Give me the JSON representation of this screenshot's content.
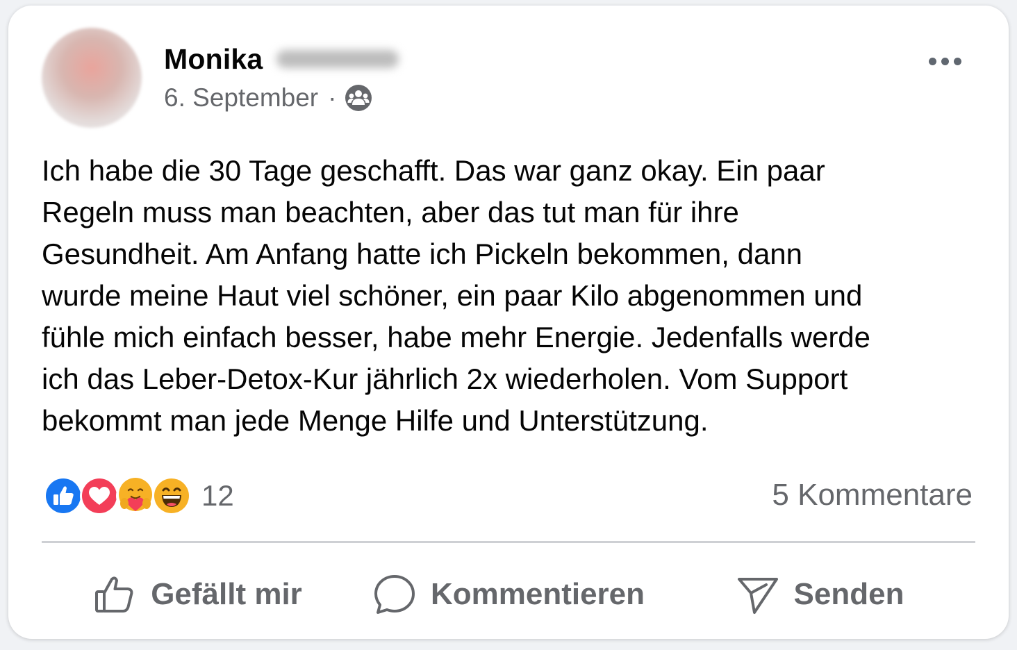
{
  "post": {
    "author_name": "Monika",
    "date": "6. September",
    "separator": "·",
    "audience_icon": "group-icon",
    "more_icon": "more-options-icon",
    "text": "Ich habe die 30 Tage geschafft. Das war ganz okay. Ein paar\nRegeln muss man beachten, aber das tut man für ihre\nGesundheit. Am Anfang hatte ich Pickeln bekommen, dann\nwurde meine Haut viel schöner, ein paar Kilo abgenommen und\nfühle mich einfach besser, habe mehr Energie. Jedenfalls werde\nich das Leber-Detox-Kur jährlich 2x wiederholen. Vom Support\nbekommt man jede Menge Hilfe und Unterstützung."
  },
  "reactions": {
    "icons": [
      "like-reaction-icon",
      "love-reaction-icon",
      "care-reaction-icon",
      "haha-reaction-icon"
    ],
    "count": "12"
  },
  "comments": {
    "label": "5 Kommentare"
  },
  "actions": {
    "like_label": "Gefällt mir",
    "comment_label": "Kommentieren",
    "send_label": "Senden"
  },
  "colors": {
    "like_blue": "#1877f2",
    "love_red": "#f33e58",
    "emoji_yellow": "#f7b125",
    "secondary_text": "#65676b",
    "primary_text": "#050505"
  }
}
